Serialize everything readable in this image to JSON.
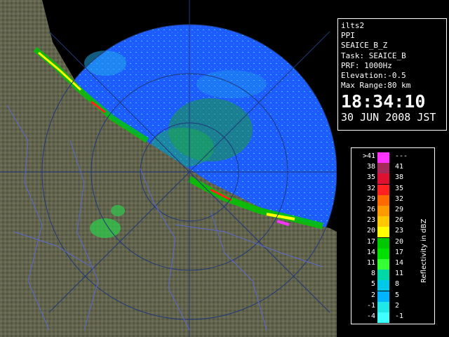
{
  "info": {
    "site": "ilts2",
    "product": "PPI",
    "scan": "SEAICE_B_Z",
    "task": "Task: SEAICE_B",
    "prf": "PRF: 1000Hz",
    "elevation": "Elevation:-0.5",
    "range": "Max Range:80 km",
    "time": "18:34:10",
    "date": "30 JUN 2008 JST"
  },
  "scale": {
    "title": "Reflectivity in dBZ",
    "rows": [
      {
        "lo": ">41",
        "hi": "---",
        "color": "#ff33ff"
      },
      {
        "lo": "38",
        "hi": "41",
        "color": "#a52a5a"
      },
      {
        "lo": "35",
        "hi": "38",
        "color": "#e01030"
      },
      {
        "lo": "32",
        "hi": "35",
        "color": "#ff2020"
      },
      {
        "lo": "29",
        "hi": "32",
        "color": "#ff6a00"
      },
      {
        "lo": "26",
        "hi": "29",
        "color": "#ff9a00"
      },
      {
        "lo": "23",
        "hi": "26",
        "color": "#ffc800"
      },
      {
        "lo": "20",
        "hi": "23",
        "color": "#ffff00"
      },
      {
        "lo": "17",
        "hi": "20",
        "color": "#00c800"
      },
      {
        "lo": "14",
        "hi": "17",
        "color": "#00e000"
      },
      {
        "lo": "11",
        "hi": "14",
        "color": "#33ff33"
      },
      {
        "lo": "8",
        "hi": "11",
        "color": "#00d8a8"
      },
      {
        "lo": "5",
        "hi": "8",
        "color": "#00c8e8"
      },
      {
        "lo": "2",
        "hi": "5",
        "color": "#00b4ff"
      },
      {
        "lo": "-1",
        "hi": "2",
        "color": "#20e8e8"
      },
      {
        "lo": "-4",
        "hi": "-1",
        "color": "#40ffff"
      }
    ]
  },
  "colors": {
    "sea": "#1e64ff",
    "land": "#6b5a3e",
    "ring": "#0c3c8c"
  }
}
